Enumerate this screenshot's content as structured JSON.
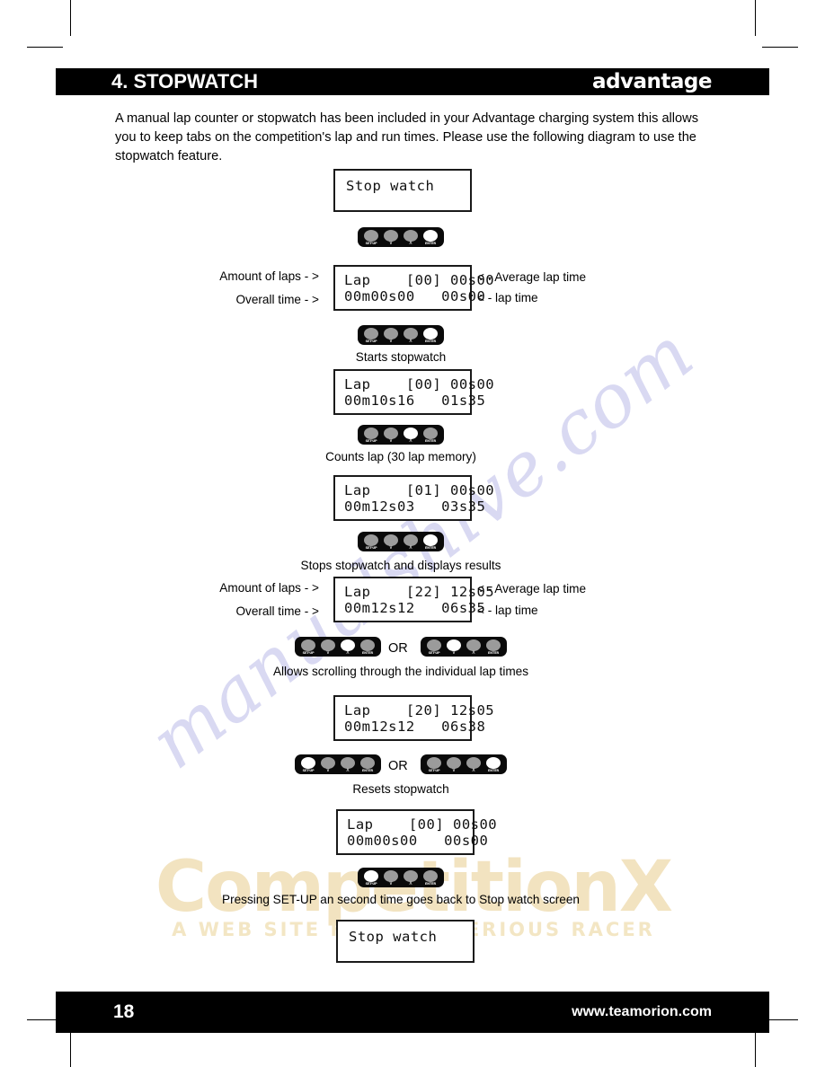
{
  "header": {
    "chapter_title": "4. STOPWATCH",
    "brand": "advantage"
  },
  "intro": {
    "paragraph": "A manual lap counter or stopwatch has been included in your Advantage charging system this allows you to keep tabs on the competition's lap and run times.  Please use the following diagram to use the stopwatch feature."
  },
  "buttons": {
    "setup_label": "SET-UP",
    "down_label": "∨",
    "up_label": "∧",
    "enter_label": "ENTER"
  },
  "flow": {
    "screen_1": {
      "line1": "Stop watch",
      "line2": ""
    },
    "panel_1": {
      "active": "enter"
    },
    "screen_2": {
      "line1": "Lap    [00] 00s00",
      "line2": "00m00s00   00s00"
    },
    "screen_2_annotations": {
      "left_top": "Amount of laps  - >",
      "left_bottom": "Overall time - >",
      "right_top": "< - Average lap time",
      "right_bottom": "< - lap time"
    },
    "panel_2": {
      "active": "enter",
      "caption": "Starts stopwatch"
    },
    "screen_3": {
      "line1": "Lap    [00] 00s00",
      "line2": "00m10s16   01s35"
    },
    "panel_3": {
      "active": "up",
      "caption": "Counts lap (30 lap memory)"
    },
    "screen_4": {
      "line1": "Lap    [01] 00s00",
      "line2": "00m12s03   03s35"
    },
    "panel_4": {
      "active": "enter",
      "caption": "Stops stopwatch and displays results"
    },
    "screen_5": {
      "line1": "Lap    [22] 12s05",
      "line2": "00m12s12   06s35"
    },
    "screen_5_annotations": {
      "left_top": "Amount of laps  - >",
      "left_bottom": "Overall time - >",
      "right_top": "< - Average lap time",
      "right_bottom": "< - lap time"
    },
    "panel_5a": {
      "active": "up"
    },
    "panel_5b": {
      "active": "down"
    },
    "or_1": "OR",
    "caption_5": "Allows scrolling through the individual lap times",
    "screen_6": {
      "line1": "Lap    [20] 12s05",
      "line2": "00m12s12   06s38"
    },
    "panel_6a": {
      "active": "setup"
    },
    "panel_6b": {
      "active": "enter"
    },
    "or_2": "OR",
    "caption_6": "Resets stopwatch",
    "screen_7": {
      "line1": "Lap    [00] 00s00",
      "line2": "00m00s00   00s00"
    },
    "panel_7": {
      "active": "setup"
    },
    "caption_7": "Pressing SET-UP an second time goes back to Stop watch screen",
    "screen_8": {
      "line1": "Stop watch",
      "line2": ""
    }
  },
  "footer": {
    "page_number": "18",
    "site_url": "www.teamorion.com"
  },
  "watermarks": {
    "manualshive": "manualshive.com",
    "competitionx_main": "CompetitionX",
    "competitionx_sub": "A WEB SITE    FOR THE SERIOUS RACER"
  },
  "colors": {
    "bar_background": "#000000",
    "bar_text": "#ffffff",
    "panel_background": "#0a0a0a",
    "button_inactive": "#9b9b9b",
    "button_active": "#ffffff",
    "watermark_purple": "#d9d9f2",
    "watermark_yellow": "#f2e3c0"
  }
}
